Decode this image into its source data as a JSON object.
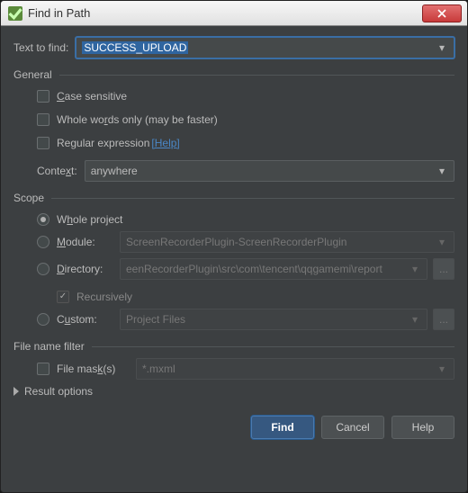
{
  "window": {
    "title": "Find in Path"
  },
  "search": {
    "label": "Text to find:",
    "value": "SUCCESS_UPLOAD"
  },
  "general": {
    "legend": "General",
    "case_sensitive": "Case sensitive",
    "whole_words": "Whole words only (may be faster)",
    "regex": "Regular expression",
    "help": "[Help]",
    "context_label": "Context:",
    "context_value": "anywhere"
  },
  "scope": {
    "legend": "Scope",
    "whole_project": "Whole project",
    "module_label": "Module:",
    "module_value": "ScreenRecorderPlugin-ScreenRecorderPlugin",
    "directory_label": "Directory:",
    "directory_value": "eenRecorderPlugin\\src\\com\\tencent\\qqgamemi\\report",
    "recursively": "Recursively",
    "custom_label": "Custom:",
    "custom_value": "Project Files"
  },
  "filter": {
    "legend": "File name filter",
    "mask_label": "File mask(s)",
    "mask_value": "*.mxml"
  },
  "result_options": "Result options",
  "buttons": {
    "find": "Find",
    "cancel": "Cancel",
    "help": "Help"
  },
  "ellipsis": "...",
  "icons": {
    "app": "✓",
    "close": "close-icon"
  }
}
